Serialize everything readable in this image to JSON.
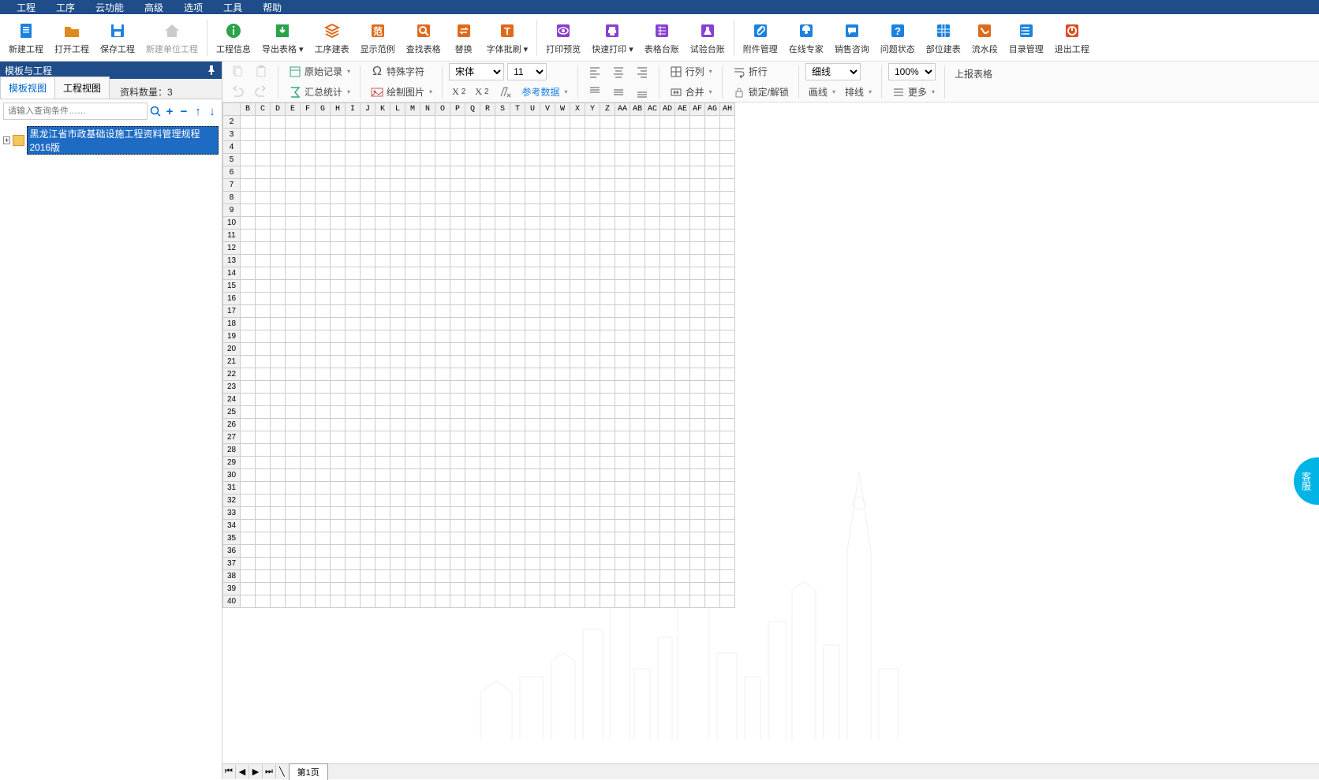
{
  "menu": [
    "工程",
    "工序",
    "云功能",
    "高级",
    "选项",
    "工具",
    "帮助"
  ],
  "main": [
    {
      "l": "新建工程",
      "c": "#1c82e0",
      "t": "doc"
    },
    {
      "l": "打开工程",
      "c": "#e08a1c",
      "t": "folder"
    },
    {
      "l": "保存工程",
      "c": "#1c82e0",
      "t": "save"
    },
    {
      "l": "新建单位工程",
      "c": "#999",
      "t": "home",
      "dis": true
    },
    {
      "sep": true
    },
    {
      "l": "工程信息",
      "c": "#2aa34a",
      "t": "info"
    },
    {
      "l": "导出表格",
      "c": "#2aa34a",
      "t": "export",
      "dd": true
    },
    {
      "l": "工序建表",
      "c": "#e06a1c",
      "t": "stack"
    },
    {
      "l": "显示范例",
      "c": "#e06a1c",
      "t": "fan"
    },
    {
      "l": "查找表格",
      "c": "#e06a1c",
      "t": "search"
    },
    {
      "l": "替换",
      "c": "#e06a1c",
      "t": "swap"
    },
    {
      "l": "字体批刷",
      "c": "#e06a1c",
      "t": "font",
      "dd": true
    },
    {
      "sep": true
    },
    {
      "l": "打印预览",
      "c": "#8a3fd0",
      "t": "eye"
    },
    {
      "l": "快速打印",
      "c": "#8a3fd0",
      "t": "print",
      "dd": true
    },
    {
      "l": "表格台账",
      "c": "#8a3fd0",
      "t": "ledger"
    },
    {
      "l": "试验台账",
      "c": "#8a3fd0",
      "t": "test"
    },
    {
      "sep": true
    },
    {
      "l": "附件管理",
      "c": "#1c82e0",
      "t": "clip"
    },
    {
      "l": "在线专家",
      "c": "#1c82e0",
      "t": "expert"
    },
    {
      "l": "销售咨询",
      "c": "#1c82e0",
      "t": "chat"
    },
    {
      "l": "问题状态",
      "c": "#1c82e0",
      "t": "qm"
    },
    {
      "l": "部位建表",
      "c": "#1c82e0",
      "t": "grid"
    },
    {
      "l": "流水段",
      "c": "#e06a1c",
      "t": "flow"
    },
    {
      "l": "目录管理",
      "c": "#1c82e0",
      "t": "list"
    },
    {
      "l": "退出工程",
      "c": "#e04a1c",
      "t": "power"
    }
  ],
  "side": {
    "title": "模板与工程",
    "tabs": [
      "模板视图",
      "工程视图"
    ],
    "count_label": "资料数量：",
    "count": "3",
    "search_ph": "请输入查询条件……",
    "tree_item": "黑龙江省市政基础设施工程资料管理规程2016版"
  },
  "tb": {
    "orig": "原始记录",
    "sum": "汇总统计",
    "spc": "特殊字符",
    "draw": "绘制图片",
    "ref": "参考数据",
    "rowcol": "行列",
    "merge": "合并",
    "wrap": "折行",
    "lock": "锁定/解锁",
    "line": "画线",
    "rline": "排线",
    "more": "更多",
    "upload": "上报表格",
    "font": "宋体",
    "size": "11",
    "border": "细线",
    "zoom": "100%"
  },
  "cols": [
    "B",
    "C",
    "D",
    "E",
    "F",
    "G",
    "H",
    "I",
    "J",
    "K",
    "L",
    "M",
    "N",
    "O",
    "P",
    "Q",
    "R",
    "S",
    "T",
    "U",
    "V",
    "W",
    "X",
    "Y",
    "Z",
    "AA",
    "AB",
    "AC",
    "AD",
    "AE",
    "AF",
    "AG",
    "AH"
  ],
  "rows": [
    2,
    3,
    4,
    5,
    6,
    7,
    8,
    9,
    10,
    11,
    12,
    13,
    14,
    15,
    16,
    17,
    18,
    19,
    20,
    21,
    22,
    23,
    24,
    25,
    26,
    27,
    28,
    29,
    30,
    31,
    32,
    33,
    34,
    35,
    36,
    37,
    38,
    39,
    40
  ],
  "nav": {
    "page": "第1页"
  },
  "cs": "客服"
}
